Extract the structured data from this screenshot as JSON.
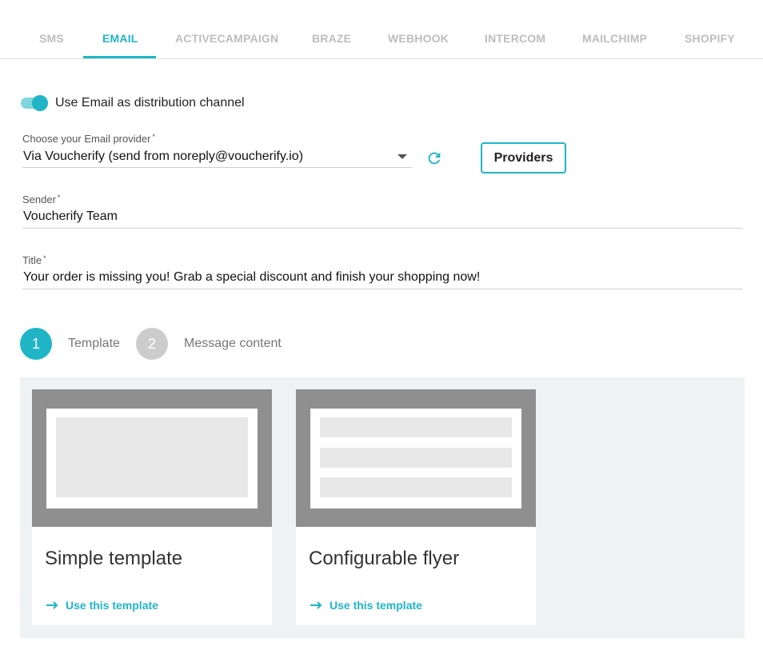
{
  "tabs": [
    {
      "label": "SMS",
      "active": false
    },
    {
      "label": "EMAIL",
      "active": true
    },
    {
      "label": "ACTIVECAMPAIGN",
      "active": false
    },
    {
      "label": "BRAZE",
      "active": false
    },
    {
      "label": "WEBHOOK",
      "active": false
    },
    {
      "label": "INTERCOM",
      "active": false
    },
    {
      "label": "MAILCHIMP",
      "active": false
    },
    {
      "label": "SHOPIFY",
      "active": false
    }
  ],
  "distribution_toggle": {
    "label": "Use Email as distribution channel",
    "enabled": true
  },
  "provider": {
    "label": "Choose your Email provider",
    "required_mark": "*",
    "value": "Via Voucherify (send from noreply@voucherify.io)",
    "refresh_icon": "refresh-icon",
    "button_label": "Providers"
  },
  "sender": {
    "label": "Sender",
    "required_mark": "*",
    "value": "Voucherify Team"
  },
  "title_field": {
    "label": "Title",
    "required_mark": "*",
    "value": "Your order is missing you! Grab a special discount and finish your shopping now!"
  },
  "steps": [
    {
      "number": "1",
      "label": "Template",
      "active": true
    },
    {
      "number": "2",
      "label": "Message content",
      "active": false
    }
  ],
  "templates": [
    {
      "title": "Simple template",
      "link_label": "Use this template"
    },
    {
      "title": "Configurable flyer",
      "link_label": "Use this template"
    }
  ],
  "colors": {
    "accent": "#1fb5c7",
    "tab_inactive": "#bdbdbd",
    "gallery_bg": "#eff2f3",
    "preview_frame": "#8f8f8f",
    "step_inactive": "#cccccc"
  }
}
